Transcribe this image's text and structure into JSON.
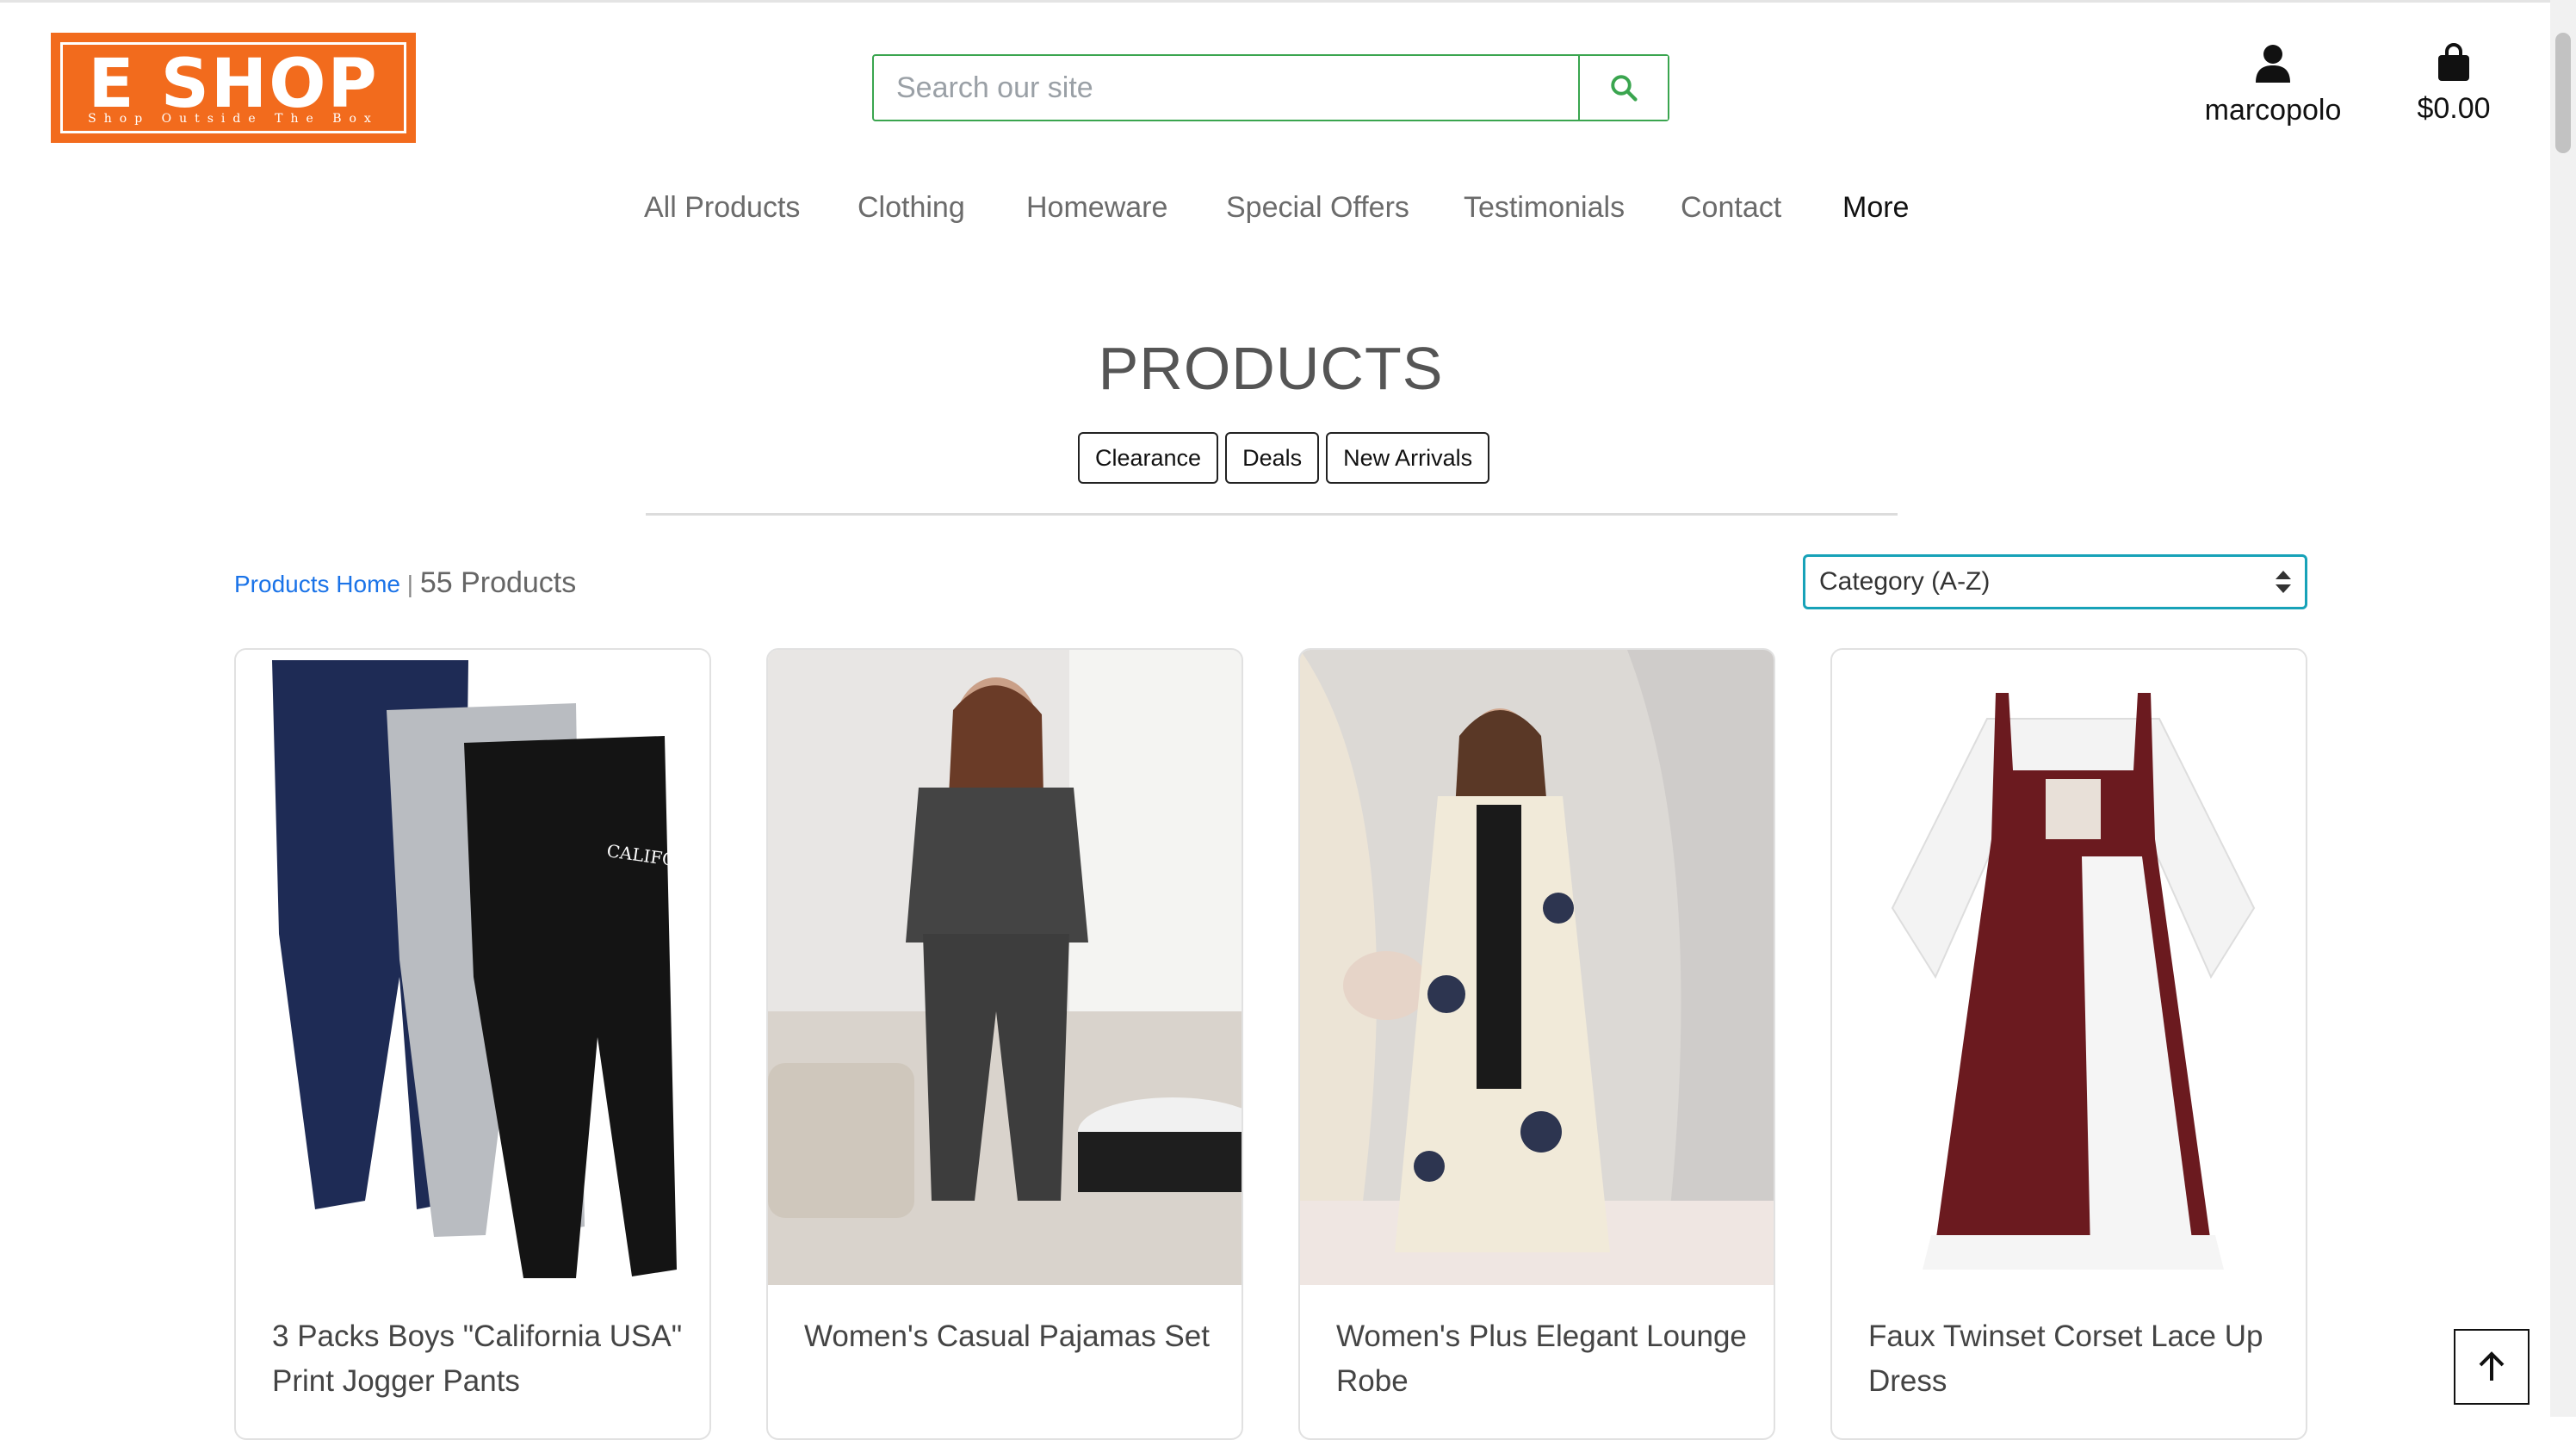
{
  "header": {
    "logo": {
      "title": "E SHOP",
      "tagline": "Shop Outside The Box"
    },
    "search": {
      "placeholder": "Search our site",
      "value": ""
    },
    "account": {
      "label": "marcopolo",
      "icon": "user-icon"
    },
    "bag": {
      "label": "$0.00",
      "icon": "shopping-bag-icon"
    }
  },
  "nav": {
    "items": [
      "All Products",
      "Clothing",
      "Homeware",
      "Special Offers",
      "Testimonials",
      "Contact",
      "More"
    ]
  },
  "main": {
    "title": "PRODUCTS",
    "filters": [
      "Clearance",
      "Deals",
      "New Arrivals"
    ],
    "breadcrumb_link": "Products Home",
    "separator": "|",
    "product_count": "55 Products",
    "sort": {
      "selected": "Category (A-Z)"
    },
    "products": [
      {
        "name": "3 Packs Boys \"California USA\" Print Jogger Pants"
      },
      {
        "name": "Women's Casual Pajamas Set"
      },
      {
        "name": "Women's Plus Elegant Lounge Robe"
      },
      {
        "name": "Faux Twinset Corset Lace Up Dress"
      }
    ]
  },
  "colors": {
    "brand": "#f26b1d",
    "search_border": "#3aa54f",
    "link": "#1a73e8",
    "sort_border": "#17a2b8"
  }
}
